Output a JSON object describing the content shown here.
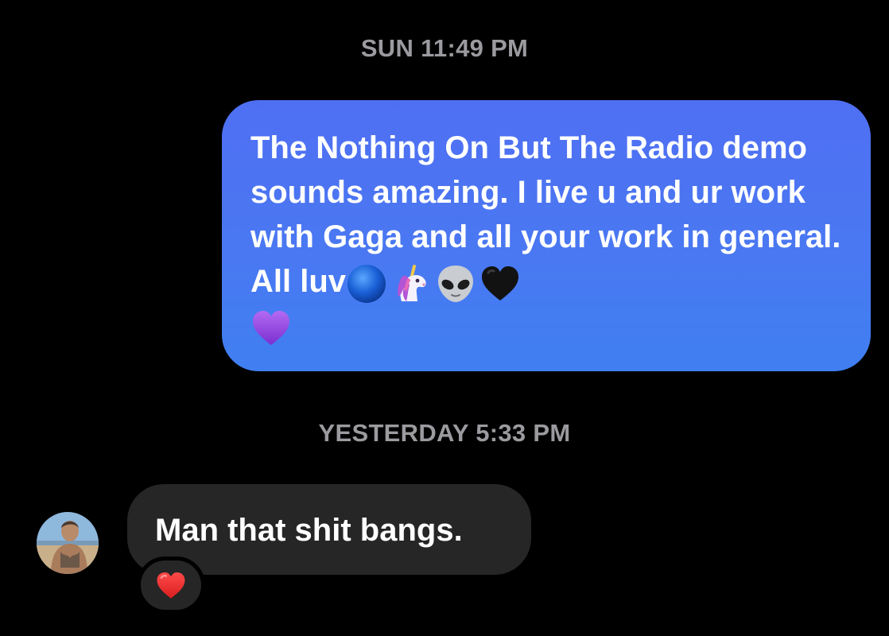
{
  "thread": {
    "timestamps": [
      "SUN 11:49 PM",
      "YESTERDAY 5:33 PM"
    ],
    "messages": [
      {
        "direction": "outgoing",
        "text": "The Nothing On But The Radio demo sounds amazing. I live u and ur work with Gaga and all your work in general. All luv",
        "emojis": [
          "blue-circle-icon",
          "unicorn-icon",
          "alien-icon",
          "black-heart-icon",
          "purple-heart-icon"
        ],
        "bubble_color": "#4a78f2"
      },
      {
        "direction": "incoming",
        "text": "Man that shit bangs.",
        "reaction": "red-heart-icon",
        "bubble_color": "#262626"
      }
    ]
  },
  "colors": {
    "background": "#000000",
    "timestamp": "#9a9a9f",
    "outgoing_bubble": "#4a78f2",
    "incoming_bubble": "#262626"
  }
}
